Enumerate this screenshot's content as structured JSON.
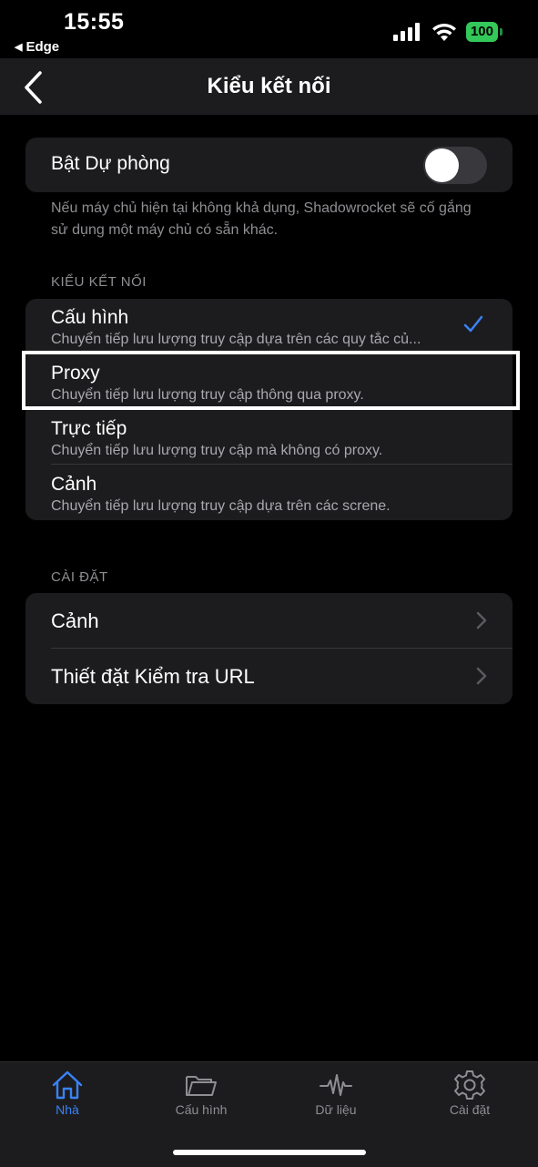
{
  "status_bar": {
    "time": "15:55",
    "back_app": "Edge",
    "battery": "100"
  },
  "nav": {
    "title": "Kiểu kết nối",
    "back_icon": "chevron-left-icon"
  },
  "fallback": {
    "label": "Bật Dự phòng",
    "enabled": false,
    "footnote": "Nếu máy chủ hiện tại không khả dụng, Shadowrocket sẽ cố gắng sử dụng một máy chủ có sẵn khác."
  },
  "connection_mode": {
    "header": "KIỂU KẾT NỐI",
    "selected": "Cấu hình",
    "items": [
      {
        "title": "Cấu hình",
        "subtitle": "Chuyển tiếp lưu lượng truy cập dựa trên các quy tắc củ..."
      },
      {
        "title": "Proxy",
        "subtitle": "Chuyển tiếp lưu lượng truy cập thông qua proxy."
      },
      {
        "title": "Trực tiếp",
        "subtitle": "Chuyển tiếp lưu lượng truy cập mà không có proxy."
      },
      {
        "title": "Cảnh",
        "subtitle": "Chuyển tiếp lưu lượng truy cập dựa trên các screne."
      }
    ]
  },
  "settings": {
    "header": "CÀI ĐẶT",
    "items": [
      {
        "label": "Cảnh"
      },
      {
        "label": "Thiết đặt Kiểm tra URL"
      }
    ]
  },
  "tabs": [
    {
      "label": "Nhà",
      "icon": "home-icon",
      "active": true
    },
    {
      "label": "Cấu hình",
      "icon": "folder-icon",
      "active": false
    },
    {
      "label": "Dữ liệu",
      "icon": "waveform-icon",
      "active": false
    },
    {
      "label": "Cài đặt",
      "icon": "gear-icon",
      "active": false
    }
  ],
  "colors": {
    "accent": "#3a82f7",
    "battery": "#34c759",
    "card_bg": "#1c1c1e"
  }
}
